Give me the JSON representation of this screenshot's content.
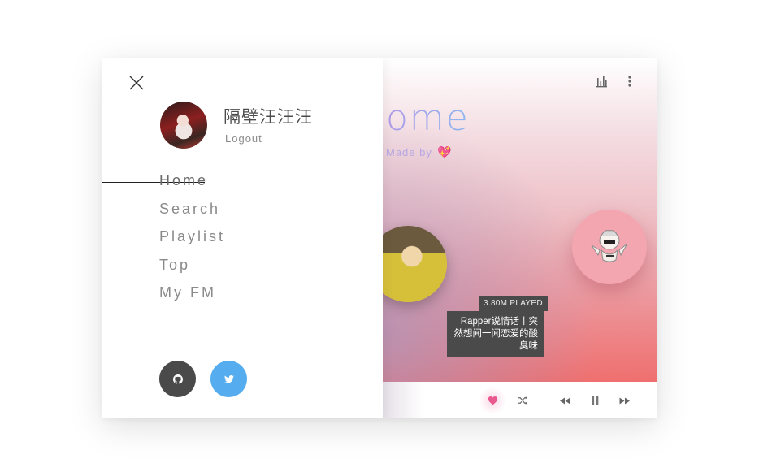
{
  "drawer": {
    "username": "隔壁汪汪汪",
    "logout_label": "Logout",
    "nav": [
      {
        "label": "Home",
        "active": true
      },
      {
        "label": "Search",
        "active": false
      },
      {
        "label": "Playlist",
        "active": false
      },
      {
        "label": "Top",
        "active": false
      },
      {
        "label": "My FM",
        "active": false
      }
    ],
    "social": [
      "github-icon",
      "twitter-icon"
    ]
  },
  "main": {
    "title": "ome",
    "made_by": "Made by",
    "heart_emoji": "💖",
    "played": "3.80M PLAYED",
    "song_title": "Rapper说情话丨突然想闻一闻恋爱的酸臭味"
  },
  "player": {
    "liked": true,
    "controls": [
      "heart-icon",
      "shuffle-icon",
      "rewind-icon",
      "pause-icon",
      "fast-forward-icon"
    ]
  },
  "colors": {
    "accent_purple": "#a999e6",
    "like_pink": "#e9588e",
    "twitter_blue": "#55acee",
    "github_dark": "#4a4a4a"
  }
}
